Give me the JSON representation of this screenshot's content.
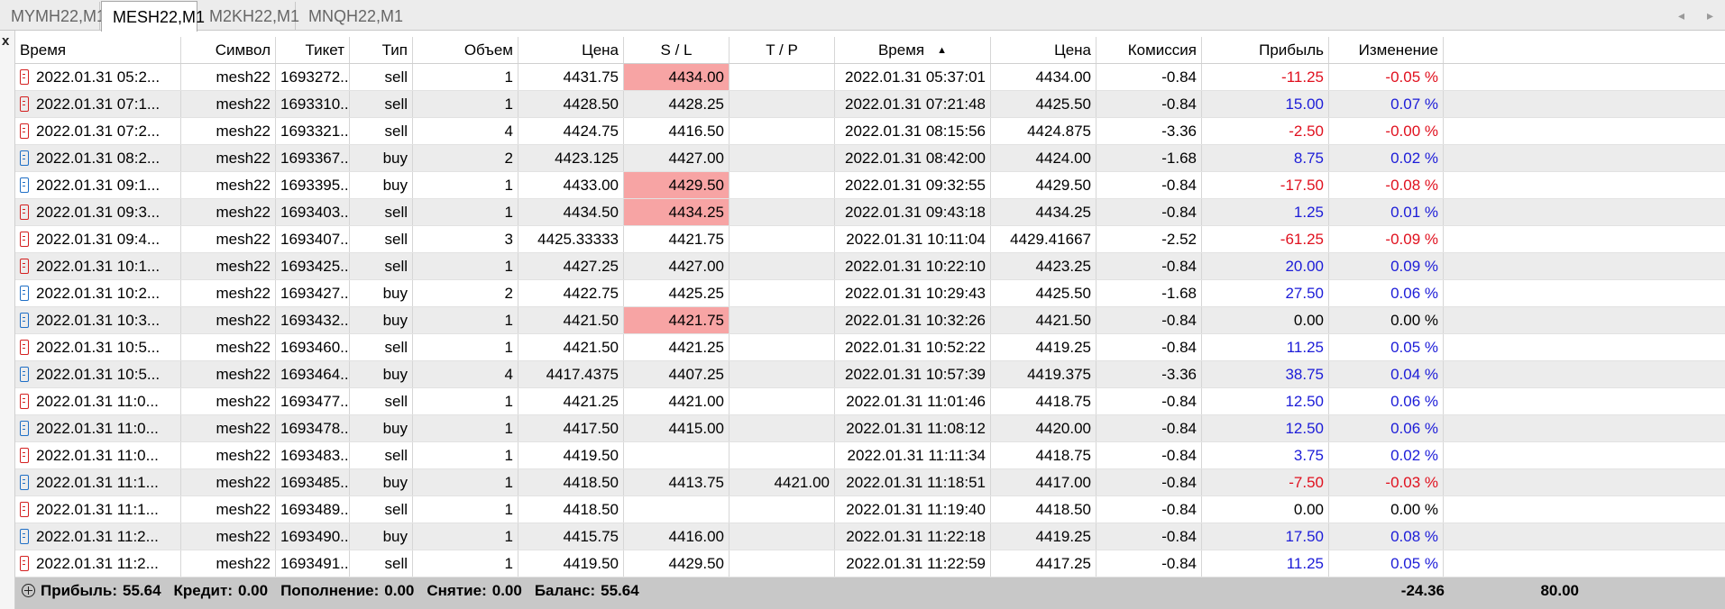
{
  "tabs": [
    {
      "label": "MYMH22,M1",
      "active": false
    },
    {
      "label": "MESH22,M1",
      "active": true
    },
    {
      "label": "M2KH22,M1",
      "active": false
    },
    {
      "label": "MNQH22,M1",
      "active": false
    }
  ],
  "close_glyph": "x",
  "columns": [
    "Время",
    "Символ",
    "Тикет",
    "Тип",
    "Объем",
    "Цена",
    "S / L",
    "T / P",
    "Время",
    "Цена",
    "Комиссия",
    "Прибыль",
    "Изменение"
  ],
  "sort_column": 8,
  "sort_direction": "ascending",
  "colors": {
    "sl_hit": "#f7a4a4",
    "profit_negative": "#e0101e",
    "profit_positive": "#1c1cd8",
    "sell_icon": "#d42020",
    "buy_icon": "#1f6fc6"
  },
  "rows": [
    {
      "open_time": "2022.01.31 05:2...",
      "symbol": "mesh22",
      "ticket": "1693272...",
      "type": "sell",
      "volume": "1",
      "price": "4431.75",
      "sl": "4434.00",
      "sl_hit": true,
      "tp": "",
      "close_time": "2022.01.31 05:37:01",
      "close_price": "4434.00",
      "commission": "-0.84",
      "profit": "-11.25",
      "change": "-0.05 %",
      "sign": "neg"
    },
    {
      "open_time": "2022.01.31 07:1...",
      "symbol": "mesh22",
      "ticket": "1693310...",
      "type": "sell",
      "volume": "1",
      "price": "4428.50",
      "sl": "4428.25",
      "sl_hit": false,
      "tp": "",
      "close_time": "2022.01.31 07:21:48",
      "close_price": "4425.50",
      "commission": "-0.84",
      "profit": "15.00",
      "change": "0.07 %",
      "sign": "pos"
    },
    {
      "open_time": "2022.01.31 07:2...",
      "symbol": "mesh22",
      "ticket": "1693321...",
      "type": "sell",
      "volume": "4",
      "price": "4424.75",
      "sl": "4416.50",
      "sl_hit": false,
      "tp": "",
      "close_time": "2022.01.31 08:15:56",
      "close_price": "4424.875",
      "commission": "-3.36",
      "profit": "-2.50",
      "change": "-0.00 %",
      "sign": "neg"
    },
    {
      "open_time": "2022.01.31 08:2...",
      "symbol": "mesh22",
      "ticket": "1693367...",
      "type": "buy",
      "volume": "2",
      "price": "4423.125",
      "sl": "4427.00",
      "sl_hit": false,
      "tp": "",
      "close_time": "2022.01.31 08:42:00",
      "close_price": "4424.00",
      "commission": "-1.68",
      "profit": "8.75",
      "change": "0.02 %",
      "sign": "pos"
    },
    {
      "open_time": "2022.01.31 09:1...",
      "symbol": "mesh22",
      "ticket": "1693395...",
      "type": "buy",
      "volume": "1",
      "price": "4433.00",
      "sl": "4429.50",
      "sl_hit": true,
      "tp": "",
      "close_time": "2022.01.31 09:32:55",
      "close_price": "4429.50",
      "commission": "-0.84",
      "profit": "-17.50",
      "change": "-0.08 %",
      "sign": "neg"
    },
    {
      "open_time": "2022.01.31 09:3...",
      "symbol": "mesh22",
      "ticket": "1693403...",
      "type": "sell",
      "volume": "1",
      "price": "4434.50",
      "sl": "4434.25",
      "sl_hit": true,
      "tp": "",
      "close_time": "2022.01.31 09:43:18",
      "close_price": "4434.25",
      "commission": "-0.84",
      "profit": "1.25",
      "change": "0.01 %",
      "sign": "pos"
    },
    {
      "open_time": "2022.01.31 09:4...",
      "symbol": "mesh22",
      "ticket": "1693407...",
      "type": "sell",
      "volume": "3",
      "price": "4425.33333",
      "sl": "4421.75",
      "sl_hit": false,
      "tp": "",
      "close_time": "2022.01.31 10:11:04",
      "close_price": "4429.41667",
      "commission": "-2.52",
      "profit": "-61.25",
      "change": "-0.09 %",
      "sign": "neg"
    },
    {
      "open_time": "2022.01.31 10:1...",
      "symbol": "mesh22",
      "ticket": "1693425...",
      "type": "sell",
      "volume": "1",
      "price": "4427.25",
      "sl": "4427.00",
      "sl_hit": false,
      "tp": "",
      "close_time": "2022.01.31 10:22:10",
      "close_price": "4423.25",
      "commission": "-0.84",
      "profit": "20.00",
      "change": "0.09 %",
      "sign": "pos"
    },
    {
      "open_time": "2022.01.31 10:2...",
      "symbol": "mesh22",
      "ticket": "1693427...",
      "type": "buy",
      "volume": "2",
      "price": "4422.75",
      "sl": "4425.25",
      "sl_hit": false,
      "tp": "",
      "close_time": "2022.01.31 10:29:43",
      "close_price": "4425.50",
      "commission": "-1.68",
      "profit": "27.50",
      "change": "0.06 %",
      "sign": "pos"
    },
    {
      "open_time": "2022.01.31 10:3...",
      "symbol": "mesh22",
      "ticket": "1693432...",
      "type": "buy",
      "volume": "1",
      "price": "4421.50",
      "sl": "4421.75",
      "sl_hit": true,
      "tp": "",
      "close_time": "2022.01.31 10:32:26",
      "close_price": "4421.50",
      "commission": "-0.84",
      "profit": "0.00",
      "change": "0.00 %",
      "sign": "zero"
    },
    {
      "open_time": "2022.01.31 10:5...",
      "symbol": "mesh22",
      "ticket": "1693460...",
      "type": "sell",
      "volume": "1",
      "price": "4421.50",
      "sl": "4421.25",
      "sl_hit": false,
      "tp": "",
      "close_time": "2022.01.31 10:52:22",
      "close_price": "4419.25",
      "commission": "-0.84",
      "profit": "11.25",
      "change": "0.05 %",
      "sign": "pos"
    },
    {
      "open_time": "2022.01.31 10:5...",
      "symbol": "mesh22",
      "ticket": "1693464...",
      "type": "buy",
      "volume": "4",
      "price": "4417.4375",
      "sl": "4407.25",
      "sl_hit": false,
      "tp": "",
      "close_time": "2022.01.31 10:57:39",
      "close_price": "4419.375",
      "commission": "-3.36",
      "profit": "38.75",
      "change": "0.04 %",
      "sign": "pos"
    },
    {
      "open_time": "2022.01.31 11:0...",
      "symbol": "mesh22",
      "ticket": "1693477...",
      "type": "sell",
      "volume": "1",
      "price": "4421.25",
      "sl": "4421.00",
      "sl_hit": false,
      "tp": "",
      "close_time": "2022.01.31 11:01:46",
      "close_price": "4418.75",
      "commission": "-0.84",
      "profit": "12.50",
      "change": "0.06 %",
      "sign": "pos"
    },
    {
      "open_time": "2022.01.31 11:0...",
      "symbol": "mesh22",
      "ticket": "1693478...",
      "type": "buy",
      "volume": "1",
      "price": "4417.50",
      "sl": "4415.00",
      "sl_hit": false,
      "tp": "",
      "close_time": "2022.01.31 11:08:12",
      "close_price": "4420.00",
      "commission": "-0.84",
      "profit": "12.50",
      "change": "0.06 %",
      "sign": "pos"
    },
    {
      "open_time": "2022.01.31 11:0...",
      "symbol": "mesh22",
      "ticket": "1693483...",
      "type": "sell",
      "volume": "1",
      "price": "4419.50",
      "sl": "",
      "sl_hit": false,
      "tp": "",
      "close_time": "2022.01.31 11:11:34",
      "close_price": "4418.75",
      "commission": "-0.84",
      "profit": "3.75",
      "change": "0.02 %",
      "sign": "pos"
    },
    {
      "open_time": "2022.01.31 11:1...",
      "symbol": "mesh22",
      "ticket": "1693485...",
      "type": "buy",
      "volume": "1",
      "price": "4418.50",
      "sl": "4413.75",
      "sl_hit": false,
      "tp": "4421.00",
      "close_time": "2022.01.31 11:18:51",
      "close_price": "4417.00",
      "commission": "-0.84",
      "profit": "-7.50",
      "change": "-0.03 %",
      "sign": "neg"
    },
    {
      "open_time": "2022.01.31 11:1...",
      "symbol": "mesh22",
      "ticket": "1693489...",
      "type": "sell",
      "volume": "1",
      "price": "4418.50",
      "sl": "",
      "sl_hit": false,
      "tp": "",
      "close_time": "2022.01.31 11:19:40",
      "close_price": "4418.50",
      "commission": "-0.84",
      "profit": "0.00",
      "change": "0.00 %",
      "sign": "zero"
    },
    {
      "open_time": "2022.01.31 11:2...",
      "symbol": "mesh22",
      "ticket": "1693490...",
      "type": "buy",
      "volume": "1",
      "price": "4415.75",
      "sl": "4416.00",
      "sl_hit": false,
      "tp": "",
      "close_time": "2022.01.31 11:22:18",
      "close_price": "4419.25",
      "commission": "-0.84",
      "profit": "17.50",
      "change": "0.08 %",
      "sign": "pos"
    },
    {
      "open_time": "2022.01.31 11:2...",
      "symbol": "mesh22",
      "ticket": "1693491...",
      "type": "sell",
      "volume": "1",
      "price": "4419.50",
      "sl": "4429.50",
      "sl_hit": false,
      "tp": "",
      "close_time": "2022.01.31 11:22:59",
      "close_price": "4417.25",
      "commission": "-0.84",
      "profit": "11.25",
      "change": "0.05 %",
      "sign": "pos"
    }
  ],
  "summary": {
    "profit_label": "Прибыль:",
    "profit_value": "55.64",
    "credit_label": "Кредит:",
    "credit_value": "0.00",
    "deposit_label": "Пополнение:",
    "deposit_value": "0.00",
    "withdrawal_label": "Снятие:",
    "withdrawal_value": "0.00",
    "balance_label": "Баланс:",
    "balance_value": "55.64",
    "total_commission": "-24.36",
    "total_profit": "80.00"
  }
}
